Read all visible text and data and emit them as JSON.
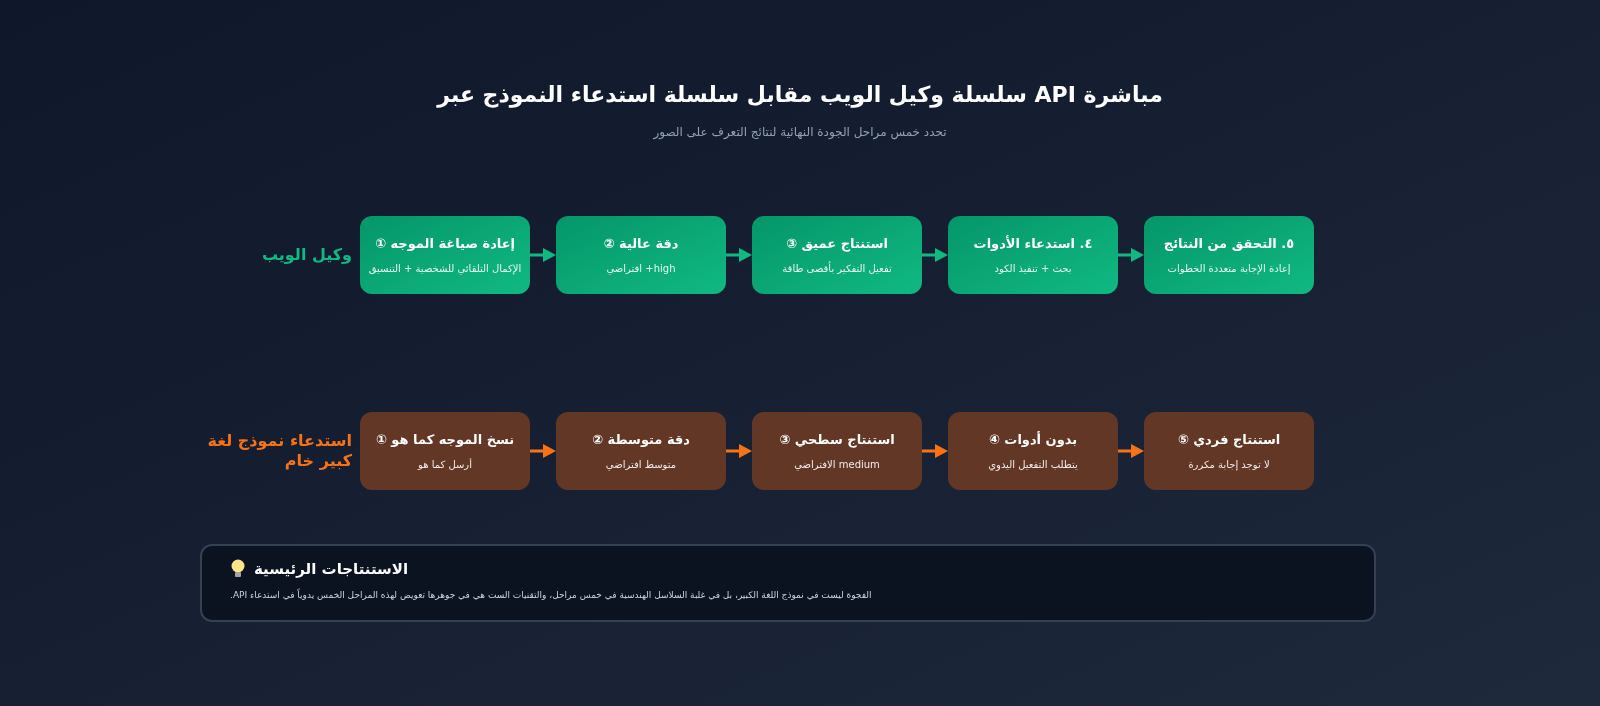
{
  "title": "مباشرة API سلسلة وكيل الويب مقابل سلسلة استدعاء النموذج عبر",
  "subtitle": "تحدد خمس مراحل الجودة النهائية لنتائج التعرف على الصور",
  "pipelines": [
    {
      "label": "وكيل الويب",
      "color": "#10b981",
      "steps": [
        {
          "title": "٥. التحقق من النتائج",
          "detail": "إعادة الإجابة متعددة الخطوات"
        },
        {
          "title": "٤. استدعاء الأدوات",
          "detail": "بحث + تنفيذ الكود"
        },
        {
          "title": "استنتاج عميق ③",
          "detail": "تفعيل التفكير بأقصى طاقة"
        },
        {
          "title": "دقة عالية ②",
          "detail": "high+ افتراضي"
        },
        {
          "title": "إعادة صياغة الموجه ①",
          "detail": "الإكمال التلقائي للشخصية + التنسيق"
        }
      ]
    },
    {
      "label": "استدعاء نموذج لغة كبير خام",
      "color": "#f97316",
      "steps": [
        {
          "title": "استنتاج فردي ⑤",
          "detail": "لا توجد إجابة مكررة"
        },
        {
          "title": "بدون أدوات ④",
          "detail": "يتطلب التفعيل اليدوي"
        },
        {
          "title": "استنتاج سطحي ③",
          "detail": "medium الافتراضي"
        },
        {
          "title": "دقة متوسطة ②",
          "detail": "متوسط افتراضي"
        },
        {
          "title": "نسخ الموجه كما هو ①",
          "detail": "أرسل كما هو"
        }
      ]
    }
  ],
  "conclusions": {
    "heading": "الاستنتاجات الرئيسية",
    "text": "الفجوة ليست في نموذج اللغة الكبير، بل في غلبة السلاسل الهندسية في خمس مراحل، والتقنيات الست هي في جوهرها تعويض لهذه المراحل الخمس يدوياً في استدعاء API."
  }
}
